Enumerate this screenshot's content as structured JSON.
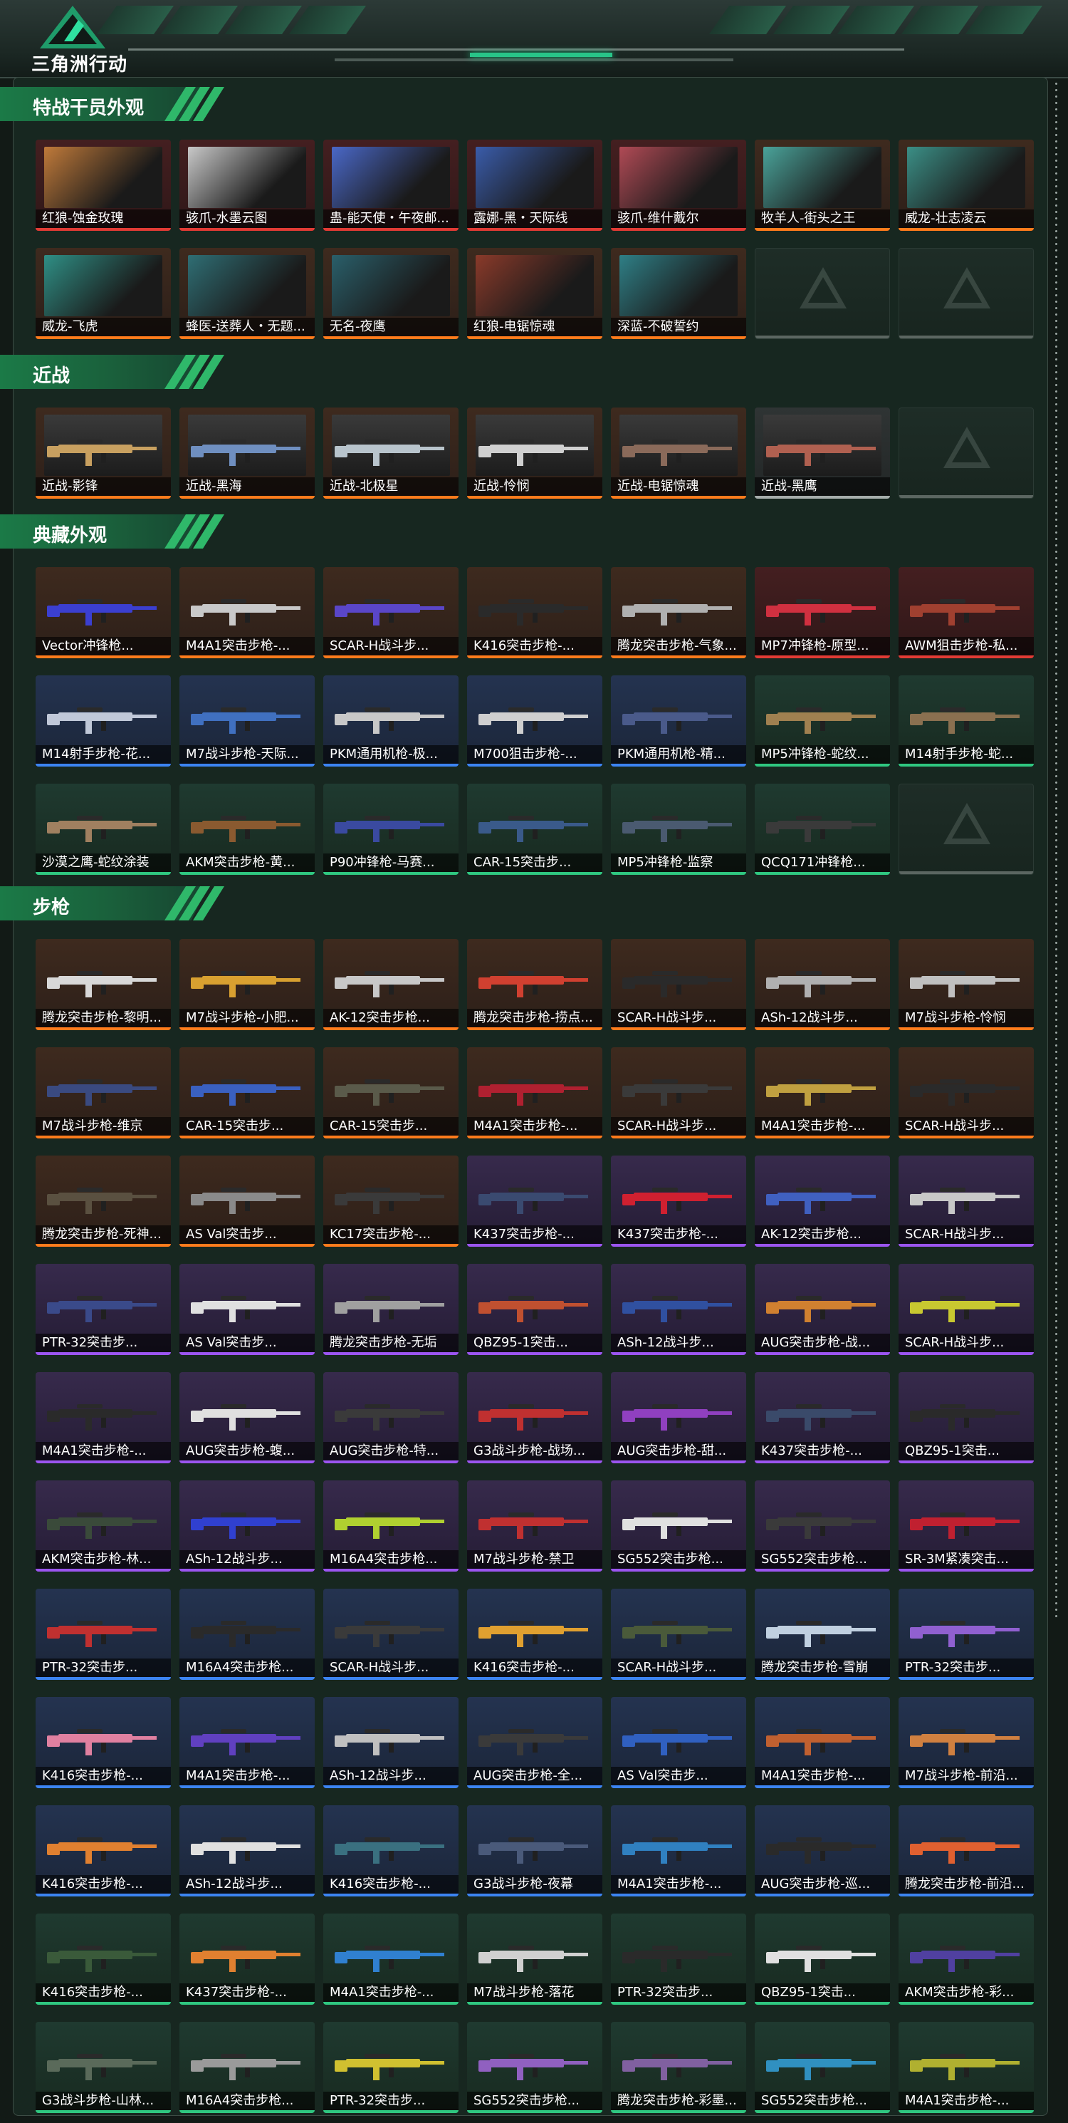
{
  "header": {
    "brand": "三角洲行动",
    "logo_icon": "delta-logo-icon"
  },
  "colors": {
    "accent": "#28c488",
    "orange": "#ff7b1c",
    "red": "#e23b35",
    "purple": "#9b55f0",
    "blue": "#3c84f2",
    "green": "#2fc780",
    "gray": "#a6adab"
  },
  "sections": [
    {
      "title": "特战干员外观",
      "items": [
        {
          "label": "红狼-蚀金玫瑰",
          "rarity": "red",
          "hue": "#c07a3a"
        },
        {
          "label": "骇爪-水墨云图",
          "rarity": "red",
          "hue": "#c9c9c9"
        },
        {
          "label": "蛊-能天使・午夜邮...",
          "rarity": "red",
          "hue": "#4a68c8"
        },
        {
          "label": "露娜-黑・天际线",
          "rarity": "red",
          "hue": "#3a5caa"
        },
        {
          "label": "骇爪-维什戴尔",
          "rarity": "red",
          "hue": "#b04a55"
        },
        {
          "label": "牧羊人-街头之王",
          "rarity": "orange",
          "hue": "#4aa39a"
        },
        {
          "label": "威龙-壮志凌云",
          "rarity": "orange",
          "hue": "#3b8f86"
        },
        {
          "label": "威龙-飞虎",
          "rarity": "orange",
          "hue": "#2f8f85"
        },
        {
          "label": "蜂医-送葬人・无题...",
          "rarity": "orange",
          "hue": "#2f6e74"
        },
        {
          "label": "无名-夜鹰",
          "rarity": "orange",
          "hue": "#2a5f6a"
        },
        {
          "label": "红狼-电锯惊魂",
          "rarity": "orange",
          "hue": "#8a3a2a"
        },
        {
          "label": "深蓝-不破誓约",
          "rarity": "orange",
          "hue": "#2f7f86"
        },
        {
          "label": "",
          "rarity": "empty"
        },
        {
          "label": "",
          "rarity": "empty"
        }
      ]
    },
    {
      "title": "近战",
      "items": [
        {
          "label": "近战-影锋",
          "rarity": "orange",
          "hue": "#c8a060"
        },
        {
          "label": "近战-黑海",
          "rarity": "orange",
          "hue": "#6f8fc0"
        },
        {
          "label": "近战-北极星",
          "rarity": "orange",
          "hue": "#b8c4cc"
        },
        {
          "label": "近战-怜悯",
          "rarity": "orange",
          "hue": "#d0d0d0"
        },
        {
          "label": "近战-电锯惊魂",
          "rarity": "orange",
          "hue": "#8a6a5a"
        },
        {
          "label": "近战-黑鹰",
          "rarity": "gray",
          "hue": "#b06050"
        },
        {
          "label": "",
          "rarity": "empty"
        }
      ]
    },
    {
      "title": "典藏外观",
      "items": [
        {
          "label": "Vector冲锋枪...",
          "rarity": "orange",
          "hue": "#3b3fd0"
        },
        {
          "label": "M4A1突击步枪-...",
          "rarity": "orange",
          "hue": "#c9c9c9"
        },
        {
          "label": "SCAR-H战斗步...",
          "rarity": "orange",
          "hue": "#5a46c8"
        },
        {
          "label": "K416突击步枪-...",
          "rarity": "orange",
          "hue": "#2a2a2a"
        },
        {
          "label": "腾龙突击步枪-气象...",
          "rarity": "orange",
          "hue": "#b0b0b0"
        },
        {
          "label": "MP7冲锋枪-原型...",
          "rarity": "red",
          "hue": "#d03040"
        },
        {
          "label": "AWM狙击步枪-私...",
          "rarity": "red",
          "hue": "#a04030"
        },
        {
          "label": "M14射手步枪-花...",
          "rarity": "blue",
          "hue": "#c0c8d8"
        },
        {
          "label": "M7战斗步枪-天际...",
          "rarity": "blue",
          "hue": "#4070c0"
        },
        {
          "label": "PKM通用机枪-极...",
          "rarity": "blue",
          "hue": "#c8c8c8"
        },
        {
          "label": "M700狙击步枪-...",
          "rarity": "blue",
          "hue": "#cfcfcf"
        },
        {
          "label": "PKM通用机枪-精...",
          "rarity": "blue",
          "hue": "#4a5a8a"
        },
        {
          "label": "MP5冲锋枪-蛇纹...",
          "rarity": "green",
          "hue": "#a08050"
        },
        {
          "label": "M14射手步枪-蛇...",
          "rarity": "green",
          "hue": "#8a7050"
        },
        {
          "label": "沙漠之鹰-蛇纹涂装",
          "rarity": "green",
          "hue": "#a08060"
        },
        {
          "label": "AKM突击步枪-黄...",
          "rarity": "green",
          "hue": "#8a5a30"
        },
        {
          "label": "P90冲锋枪-马赛...",
          "rarity": "green",
          "hue": "#3a4aa0"
        },
        {
          "label": "CAR-15突击步...",
          "rarity": "green",
          "hue": "#3a5a8a"
        },
        {
          "label": "MP5冲锋枪-监察",
          "rarity": "green",
          "hue": "#4a5a70"
        },
        {
          "label": "QCQ171冲锋枪...",
          "rarity": "green",
          "hue": "#3a3a3a"
        },
        {
          "label": "",
          "rarity": "empty"
        }
      ]
    },
    {
      "title": "步枪",
      "items": [
        {
          "label": "腾龙突击步枪-黎明...",
          "rarity": "orange",
          "hue": "#d8d8d8"
        },
        {
          "label": "M7战斗步枪-小肥...",
          "rarity": "orange",
          "hue": "#d8a030"
        },
        {
          "label": "AK-12突击步枪...",
          "rarity": "orange",
          "hue": "#c8c8c8"
        },
        {
          "label": "腾龙突击步枪-捞点...",
          "rarity": "orange",
          "hue": "#d04030"
        },
        {
          "label": "SCAR-H战斗步...",
          "rarity": "orange",
          "hue": "#2a2a2a"
        },
        {
          "label": "ASh-12战斗步...",
          "rarity": "orange",
          "hue": "#b0b0b0"
        },
        {
          "label": "M7战斗步枪-怜悯",
          "rarity": "orange",
          "hue": "#c0c0c0"
        },
        {
          "label": "M7战斗步枪-维京",
          "rarity": "orange",
          "hue": "#3a4a80"
        },
        {
          "label": "CAR-15突击步...",
          "rarity": "orange",
          "hue": "#3a60c0"
        },
        {
          "label": "CAR-15突击步...",
          "rarity": "orange",
          "hue": "#5a5a4a"
        },
        {
          "label": "M4A1突击步枪-...",
          "rarity": "orange",
          "hue": "#b02030"
        },
        {
          "label": "SCAR-H战斗步...",
          "rarity": "orange",
          "hue": "#3a3a3a"
        },
        {
          "label": "M4A1突击步枪-...",
          "rarity": "orange",
          "hue": "#c0a040"
        },
        {
          "label": "SCAR-H战斗步...",
          "rarity": "orange",
          "hue": "#2a2a2a"
        },
        {
          "label": "腾龙突击步枪-死神...",
          "rarity": "orange",
          "hue": "#5a5040"
        },
        {
          "label": "AS Val突击步...",
          "rarity": "orange",
          "hue": "#8a8a8a"
        },
        {
          "label": "KC17突击步枪-...",
          "rarity": "orange",
          "hue": "#3a3a3a"
        },
        {
          "label": "K437突击步枪-...",
          "rarity": "purple",
          "hue": "#3a4a70"
        },
        {
          "label": "K437突击步枪-...",
          "rarity": "purple",
          "hue": "#d02030"
        },
        {
          "label": "AK-12突击步枪...",
          "rarity": "purple",
          "hue": "#4060c0"
        },
        {
          "label": "SCAR-H战斗步...",
          "rarity": "purple",
          "hue": "#c8c8c8"
        },
        {
          "label": "PTR-32突击步...",
          "rarity": "purple",
          "hue": "#3a4a8a"
        },
        {
          "label": "AS Val突击步...",
          "rarity": "purple",
          "hue": "#e0e0e0"
        },
        {
          "label": "腾龙突击步枪-无垢",
          "rarity": "purple",
          "hue": "#a0a0a0"
        },
        {
          "label": "QBZ95-1突击...",
          "rarity": "purple",
          "hue": "#c05030"
        },
        {
          "label": "ASh-12战斗步...",
          "rarity": "purple",
          "hue": "#3050a0"
        },
        {
          "label": "AUG突击步枪-战...",
          "rarity": "purple",
          "hue": "#d08030"
        },
        {
          "label": "SCAR-H战斗步...",
          "rarity": "purple",
          "hue": "#c8c830"
        },
        {
          "label": "M4A1突击步枪-...",
          "rarity": "purple",
          "hue": "#2a2a2a"
        },
        {
          "label": "AUG突击步枪-蝮...",
          "rarity": "purple",
          "hue": "#e0e0e0"
        },
        {
          "label": "AUG突击步枪-特...",
          "rarity": "purple",
          "hue": "#3a3a3a"
        },
        {
          "label": "G3战斗步枪-战场...",
          "rarity": "purple",
          "hue": "#c03030"
        },
        {
          "label": "AUG突击步枪-甜...",
          "rarity": "purple",
          "hue": "#9040c0"
        },
        {
          "label": "K437突击步枪-...",
          "rarity": "purple",
          "hue": "#3a4a6a"
        },
        {
          "label": "QBZ95-1突击...",
          "rarity": "purple",
          "hue": "#2a2a2a"
        },
        {
          "label": "AKM突击步枪-林...",
          "rarity": "purple",
          "hue": "#3a4a3a"
        },
        {
          "label": "ASh-12战斗步...",
          "rarity": "purple",
          "hue": "#3040d0"
        },
        {
          "label": "M16A4突击步枪...",
          "rarity": "purple",
          "hue": "#b0d030"
        },
        {
          "label": "M7战斗步枪-禁卫",
          "rarity": "purple",
          "hue": "#c03030"
        },
        {
          "label": "SG552突击步枪...",
          "rarity": "purple",
          "hue": "#e0e0e0"
        },
        {
          "label": "SG552突击步枪...",
          "rarity": "purple",
          "hue": "#3a3a3a"
        },
        {
          "label": "SR-3M紧凑突击...",
          "rarity": "purple",
          "hue": "#c02030"
        },
        {
          "label": "PTR-32突击步...",
          "rarity": "blue",
          "hue": "#c03030"
        },
        {
          "label": "M16A4突击步枪...",
          "rarity": "blue",
          "hue": "#2a2a2a"
        },
        {
          "label": "SCAR-H战斗步...",
          "rarity": "blue",
          "hue": "#3a3a3a"
        },
        {
          "label": "K416突击步枪-...",
          "rarity": "blue",
          "hue": "#e0a030"
        },
        {
          "label": "SCAR-H战斗步...",
          "rarity": "blue",
          "hue": "#4a5a3a"
        },
        {
          "label": "腾龙突击步枪-雪崩",
          "rarity": "blue",
          "hue": "#c0d0e0"
        },
        {
          "label": "PTR-32突击步...",
          "rarity": "blue",
          "hue": "#9060d0"
        },
        {
          "label": "K416突击步枪-...",
          "rarity": "blue",
          "hue": "#e080a0"
        },
        {
          "label": "M4A1突击步枪-...",
          "rarity": "blue",
          "hue": "#6040c0"
        },
        {
          "label": "ASh-12战斗步...",
          "rarity": "blue",
          "hue": "#c0c0c0"
        },
        {
          "label": "AUG突击步枪-全...",
          "rarity": "blue",
          "hue": "#3a3a3a"
        },
        {
          "label": "AS Val突击步...",
          "rarity": "blue",
          "hue": "#3060c0"
        },
        {
          "label": "M4A1突击步枪-...",
          "rarity": "blue",
          "hue": "#c06030"
        },
        {
          "label": "M7战斗步枪-前沿...",
          "rarity": "blue",
          "hue": "#d08040"
        },
        {
          "label": "K416突击步枪-...",
          "rarity": "blue",
          "hue": "#e08030"
        },
        {
          "label": "ASh-12战斗步...",
          "rarity": "blue",
          "hue": "#e0e0e0"
        },
        {
          "label": "K416突击步枪-...",
          "rarity": "blue",
          "hue": "#3a7080"
        },
        {
          "label": "G3战斗步枪-夜幕",
          "rarity": "blue",
          "hue": "#4a5a7a"
        },
        {
          "label": "M4A1突击步枪-...",
          "rarity": "blue",
          "hue": "#3080c0"
        },
        {
          "label": "AUG突击步枪-巡...",
          "rarity": "blue",
          "hue": "#2a2a2a"
        },
        {
          "label": "腾龙突击步枪-前沿...",
          "rarity": "blue",
          "hue": "#e06030"
        },
        {
          "label": "K416突击步枪-...",
          "rarity": "green",
          "hue": "#3a5a3a"
        },
        {
          "label": "K437突击步枪-...",
          "rarity": "green",
          "hue": "#e08030"
        },
        {
          "label": "M4A1突击步枪-...",
          "rarity": "green",
          "hue": "#3080d0"
        },
        {
          "label": "M7战斗步枪-落花",
          "rarity": "green",
          "hue": "#d0d0d0"
        },
        {
          "label": "PTR-32突击步...",
          "rarity": "green",
          "hue": "#2a2a2a"
        },
        {
          "label": "QBZ95-1突击...",
          "rarity": "green",
          "hue": "#e0e0e0"
        },
        {
          "label": "AKM突击步枪-彩...",
          "rarity": "green",
          "hue": "#5040a0"
        },
        {
          "label": "G3战斗步枪-山林...",
          "rarity": "green",
          "hue": "#5a6a5a"
        },
        {
          "label": "M16A4突击步枪...",
          "rarity": "green",
          "hue": "#9a9a9a"
        },
        {
          "label": "PTR-32突击步...",
          "rarity": "green",
          "hue": "#d0c030"
        },
        {
          "label": "SG552突击步枪...",
          "rarity": "green",
          "hue": "#9060c0"
        },
        {
          "label": "腾龙突击步枪-彩墨...",
          "rarity": "green",
          "hue": "#8060a0"
        },
        {
          "label": "SG552突击步枪...",
          "rarity": "green",
          "hue": "#3090c0"
        },
        {
          "label": "M4A1突击步枪-...",
          "rarity": "green",
          "hue": "#b0b030"
        }
      ]
    }
  ]
}
